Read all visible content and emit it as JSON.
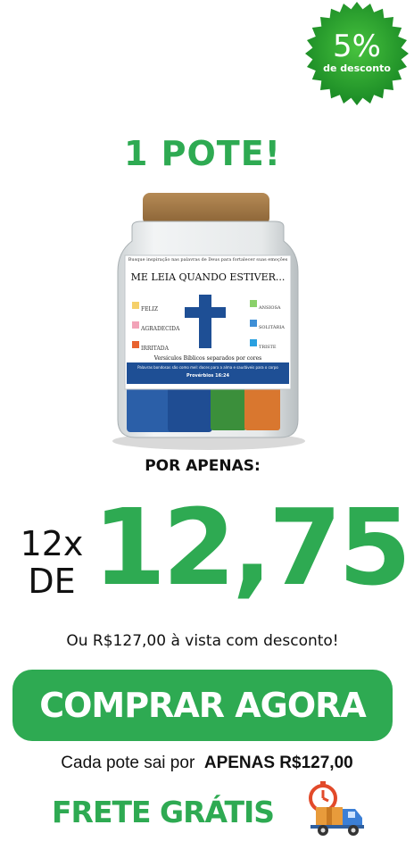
{
  "badge": {
    "percent": "5%",
    "label": "de desconto"
  },
  "headline": "1 POTE!",
  "jar_label": {
    "top_line": "Busque inspiração nas palavras de Deus para fortalecer suas emoções",
    "title": "ME LEIA QUANDO ESTIVER...",
    "left_items": [
      "FELIZ",
      "AGRADECIDA",
      "IRRITADA"
    ],
    "right_items": [
      "ANSIOSA",
      "SOLITÁRIA",
      "TRISTE"
    ],
    "caption": "Versículos Bíblicos separados por cores",
    "verse": "Palavras bondosas são como mel: doces para a alma e saudáveis para o corpo",
    "reference": "Provérbios 16:24"
  },
  "price_intro": "POR APENAS:",
  "installments": {
    "count": "12x",
    "prefix": "DE"
  },
  "price_value": "12,75",
  "cash_price_text": "Ou R$127,00 à vista com desconto!",
  "buy_button_label": "COMPRAR AGORA",
  "per_pot": {
    "prefix": "Cada pote sai por",
    "bold": "APENAS R$127,00"
  },
  "shipping_label": "FRETE GRÁTIS",
  "colors": {
    "brand_green": "#2eaa52",
    "badge_green": "#1f9a2c",
    "text": "#111111",
    "label_colors": [
      "#f5d06a",
      "#f2a3b8",
      "#e8632f",
      "#8ad06a",
      "#3f8fd6",
      "#2aa0e0"
    ]
  },
  "icons": [
    "starburst-badge",
    "cross-icon",
    "delivery-truck-icon",
    "stopwatch-icon"
  ]
}
